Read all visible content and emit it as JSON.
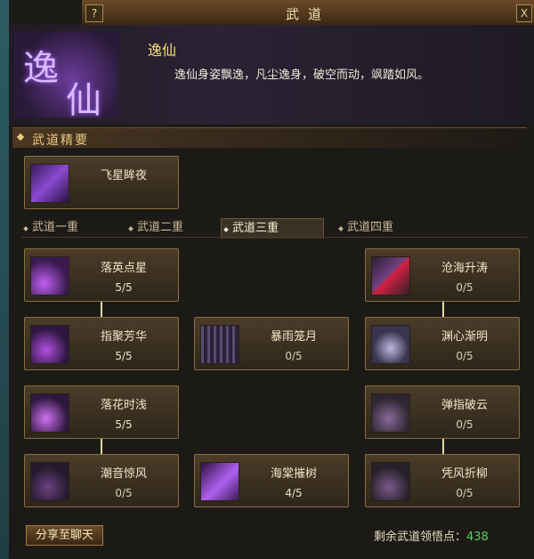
{
  "window": {
    "title": "武道",
    "help_label": "?",
    "close_label": "X"
  },
  "header": {
    "emblem_chars": [
      "逸",
      "仙"
    ],
    "name": "逸仙",
    "description": "逸仙身姿飘逸，凡尘逸身，破空而动，飒踏如风。"
  },
  "essentials": {
    "title": "武道精要",
    "skill": {
      "name": "飞星眸夜",
      "icon": "purple-skill-icon"
    }
  },
  "tabs": [
    {
      "label": "武道一重",
      "active": false
    },
    {
      "label": "武道二重",
      "active": false
    },
    {
      "label": "武道三重",
      "active": true
    },
    {
      "label": "武道四重",
      "active": false
    }
  ],
  "skills": [
    {
      "name": "落英点星",
      "level": "5/5",
      "max_fraction": 1.0
    },
    {
      "name": "沧海升涛",
      "level": "0/5",
      "max_fraction": 0.0
    },
    {
      "name": "指聚芳华",
      "level": "5/5",
      "max_fraction": 1.0
    },
    {
      "name": "暴雨笼月",
      "level": "0/5",
      "max_fraction": 0.0
    },
    {
      "name": "渊心渐明",
      "level": "0/5",
      "max_fraction": 0.0
    },
    {
      "name": "落花时浅",
      "level": "5/5",
      "max_fraction": 1.0
    },
    {
      "name": "弹指破云",
      "level": "0/5",
      "max_fraction": 0.0
    },
    {
      "name": "潮音惊风",
      "level": "0/5",
      "max_fraction": 0.0
    },
    {
      "name": "海棠摧树",
      "level": "4/5",
      "max_fraction": 0.8
    },
    {
      "name": "凭风折柳",
      "level": "0/5",
      "max_fraction": 0.0
    }
  ],
  "footer": {
    "share_label": "分享至聊天",
    "points_label": "剩余武道领悟点：",
    "points_value": "438"
  }
}
